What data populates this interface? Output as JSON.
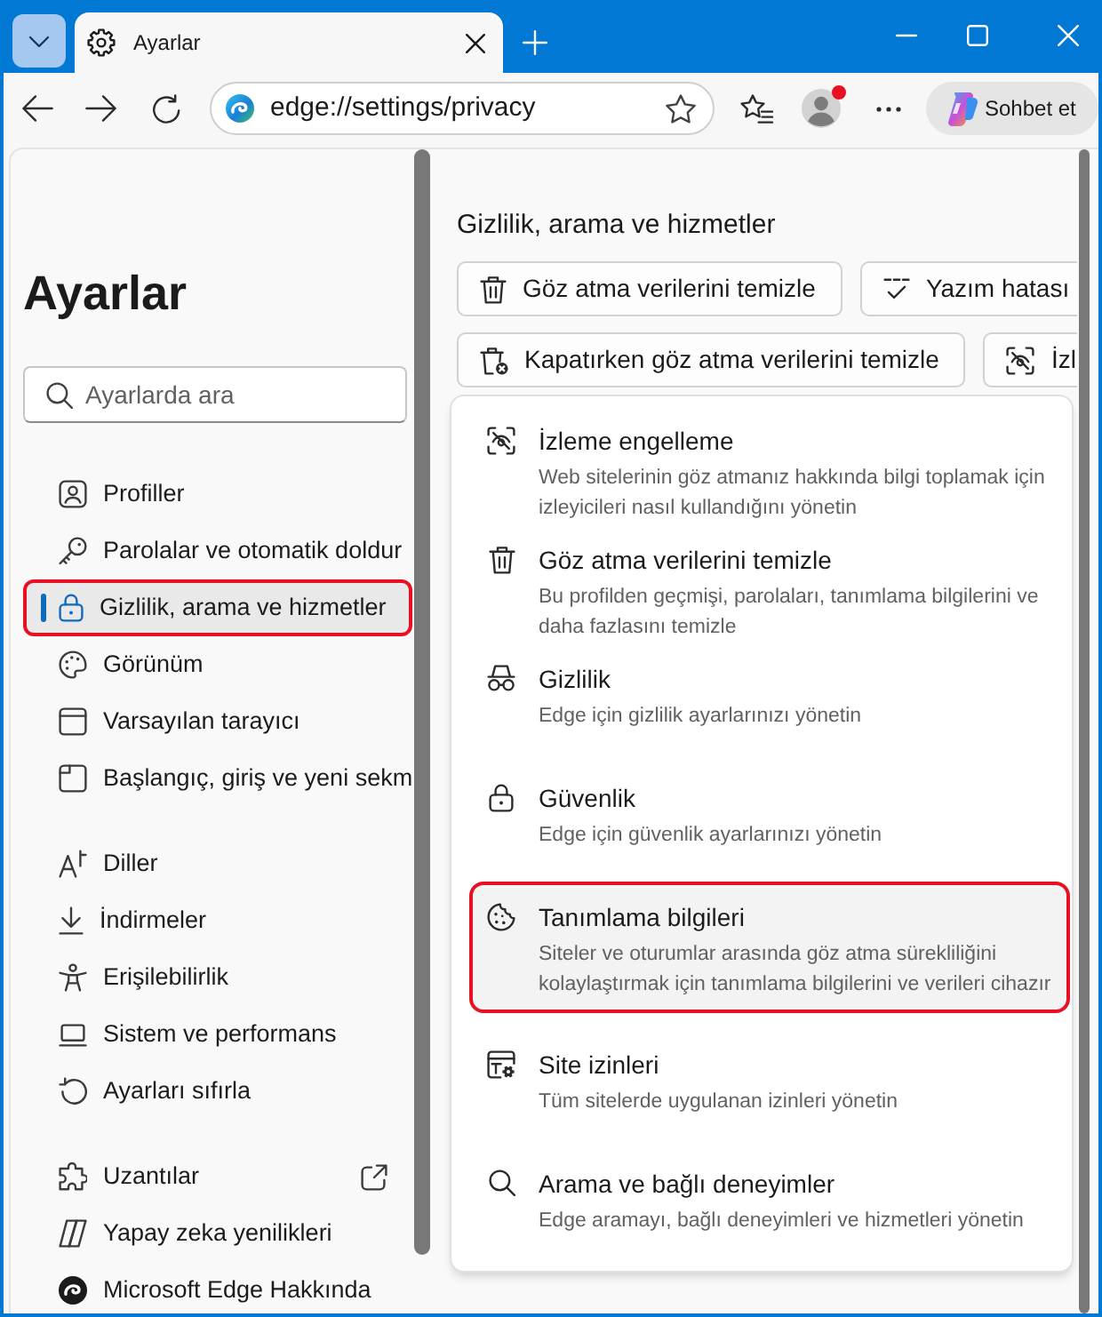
{
  "window": {
    "tabs": [
      {
        "title": "Ayarlar",
        "selected": true
      }
    ]
  },
  "toolbar": {
    "address": "edge://settings/privacy",
    "profile_notification": true,
    "chat_button": "Sohbet et"
  },
  "sidebar": {
    "title": "Ayarlar",
    "search": {
      "placeholder": "Ayarlarda ara"
    },
    "groups": [
      {
        "items": [
          {
            "label": "Profiller",
            "selected": false,
            "outlined": false,
            "external_link": false
          },
          {
            "label": "Parolalar ve otomatik doldur",
            "selected": false,
            "outlined": false,
            "external_link": false
          },
          {
            "label": "Gizlilik, arama ve hizmetler",
            "selected": true,
            "outlined": true,
            "external_link": false
          },
          {
            "label": "Görünüm",
            "selected": false,
            "outlined": false,
            "external_link": false
          },
          {
            "label": "Varsayılan tarayıcı",
            "selected": false,
            "outlined": false,
            "external_link": false
          },
          {
            "label": "Başlangıç, giriş ve yeni sekm",
            "selected": false,
            "outlined": false,
            "external_link": false
          }
        ]
      },
      {
        "items": [
          {
            "label": "Diller",
            "selected": false,
            "outlined": false,
            "external_link": false
          },
          {
            "label": "İndirmeler",
            "selected": false,
            "outlined": false,
            "external_link": false
          },
          {
            "label": "Erişilebilirlik",
            "selected": false,
            "outlined": false,
            "external_link": false
          },
          {
            "label": "Sistem ve performans",
            "selected": false,
            "outlined": false,
            "external_link": false
          },
          {
            "label": "Ayarları sıfırla",
            "selected": false,
            "outlined": false,
            "external_link": false
          }
        ]
      },
      {
        "items": [
          {
            "label": "Uzantılar",
            "selected": false,
            "outlined": false,
            "external_link": true
          },
          {
            "label": "Yapay zeka yenilikleri",
            "selected": false,
            "outlined": false,
            "external_link": false
          },
          {
            "label": "Microsoft Edge Hakkında",
            "selected": false,
            "outlined": false,
            "external_link": false
          }
        ]
      }
    ]
  },
  "main": {
    "section_title": "Gizlilik, arama ve hizmetler",
    "quick_buttons": [
      [
        {
          "label": "Göz atma verilerini temizle"
        },
        {
          "label": "Yazım hatası"
        }
      ],
      [
        {
          "label": "Kapatırken göz atma verilerini temizle"
        },
        {
          "label": "İzl"
        }
      ]
    ],
    "menu": {
      "items": [
        {
          "title": "İzleme engelleme",
          "description": "Web sitelerinin göz atmanız hakkında bilgi toplamak için izleyicileri nasıl kullandığını yönetin",
          "hovered": false,
          "outlined": false
        },
        {
          "title": "Göz atma verilerini temizle",
          "description": "Bu profilden geçmişi, parolaları, tanımlama bilgilerini ve daha fazlasını temizle",
          "hovered": false,
          "outlined": false
        },
        {
          "title": "Gizlilik",
          "description": "Edge için gizlilik ayarlarınızı yönetin",
          "hovered": false,
          "outlined": false
        },
        {
          "title": "Güvenlik",
          "description": "Edge için güvenlik ayarlarınızı yönetin",
          "hovered": false,
          "outlined": false
        },
        {
          "title": "Tanımlama bilgileri",
          "description": "Siteler ve oturumlar arasında göz atma sürekliliğini kolaylaştırmak için tanımlama bilgilerini ve verileri cihazır",
          "hovered": true,
          "outlined": true
        },
        {
          "title": "Site izinleri",
          "description": "Tüm sitelerde uygulanan izinleri yönetin",
          "hovered": false,
          "outlined": false
        },
        {
          "title": "Arama ve bağlı deneyimler",
          "description": "Edge aramayı, bağlı deneyimleri ve hizmetleri yönetin",
          "hovered": false,
          "outlined": false
        }
      ]
    }
  }
}
